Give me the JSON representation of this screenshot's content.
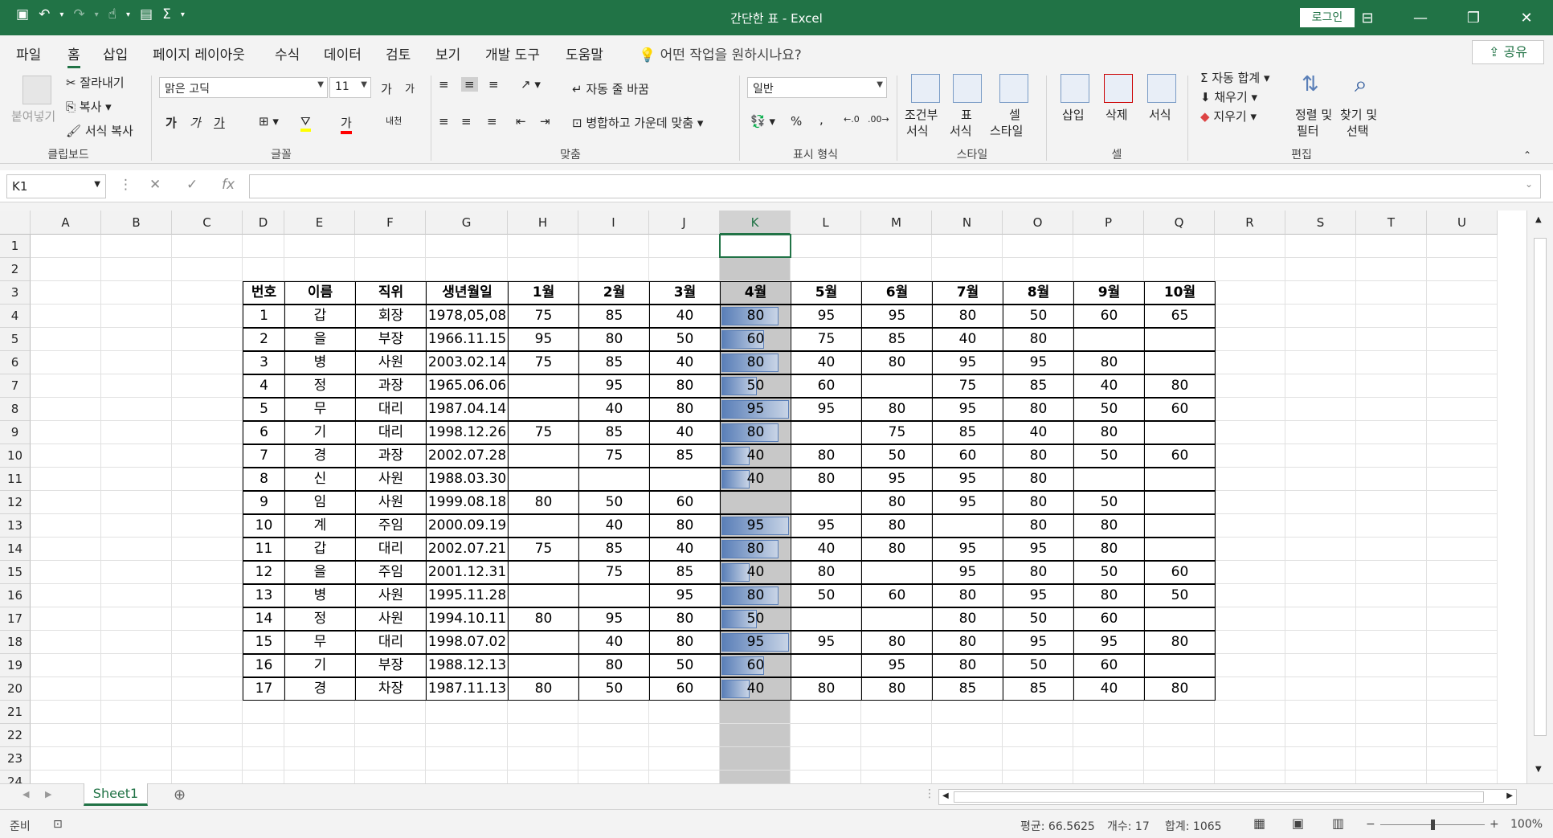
{
  "window": {
    "title": "간단한 표  -  Excel",
    "login_label": "로그인"
  },
  "menu": {
    "tabs": [
      "파일",
      "홈",
      "삽입",
      "페이지 레이아웃",
      "수식",
      "데이터",
      "검토",
      "보기",
      "개발 도구",
      "도움말"
    ],
    "tell_me": "어떤 작업을 원하시나요?",
    "share_label": "공유"
  },
  "ribbon": {
    "clipboard": {
      "paste": "붙여넣기",
      "cut": "잘라내기",
      "copy": "복사",
      "format_painter": "서식 복사",
      "group": "클립보드"
    },
    "font": {
      "name": "맑은 고딕",
      "size": "11",
      "group": "글꼴",
      "bold": "가",
      "italic": "가",
      "underline": "가",
      "grow": "가",
      "shrink": "가",
      "color": "가",
      "phonetic": "내천"
    },
    "alignment": {
      "wrap": "자동 줄 바꿈",
      "merge": "병합하고 가운데 맞춤",
      "group": "맞춤"
    },
    "number": {
      "format": "일반",
      "percent": "%",
      "comma": ",",
      "group": "표시 형식"
    },
    "styles": {
      "conditional_1": "조건부",
      "conditional_2": "서식",
      "table_1": "표",
      "table_2": "서식",
      "cell_1": "셀",
      "cell_2": "스타일",
      "group": "스타일"
    },
    "cells": {
      "insert": "삽입",
      "delete": "삭제",
      "format": "서식",
      "group": "셀"
    },
    "editing": {
      "autosum": "자동 합계",
      "fill": "채우기",
      "clear": "지우기",
      "sort_1": "정렬 및",
      "sort_2": "필터",
      "find_1": "찾기 및",
      "find_2": "선택",
      "group": "편집"
    }
  },
  "formula_bar": {
    "name_box": "K1",
    "cancel": "✕",
    "enter": "✓",
    "fx": "fx",
    "formula": ""
  },
  "sheet": {
    "columns": [
      "A",
      "B",
      "C",
      "D",
      "E",
      "F",
      "G",
      "H",
      "I",
      "J",
      "K",
      "L",
      "M",
      "N",
      "O",
      "P",
      "Q",
      "R",
      "S",
      "T",
      "U"
    ],
    "selected_column": "K",
    "rows": [
      "1",
      "2",
      "3",
      "4",
      "5",
      "6",
      "7",
      "8",
      "9",
      "10",
      "11",
      "12",
      "13",
      "14",
      "15",
      "16",
      "17",
      "18",
      "19",
      "20",
      "21",
      "22",
      "23",
      "24"
    ],
    "table_headers": [
      "번호",
      "이름",
      "직위",
      "생년월일",
      "1월",
      "2월",
      "3월",
      "4월",
      "5월",
      "6월",
      "7월",
      "8월",
      "9월",
      "10월"
    ],
    "table_rows": [
      [
        "1",
        "갑",
        "회장",
        "1978,05,08",
        "75",
        "85",
        "40",
        "80",
        "95",
        "95",
        "80",
        "50",
        "60",
        "65"
      ],
      [
        "2",
        "을",
        "부장",
        "1966.11.15",
        "95",
        "80",
        "50",
        "60",
        "75",
        "85",
        "40",
        "80",
        "",
        ""
      ],
      [
        "3",
        "병",
        "사원",
        "2003.02.14",
        "75",
        "85",
        "40",
        "80",
        "40",
        "80",
        "95",
        "95",
        "80",
        ""
      ],
      [
        "4",
        "정",
        "과장",
        "1965.06.06",
        "",
        "95",
        "80",
        "50",
        "60",
        "",
        "75",
        "85",
        "40",
        "80"
      ],
      [
        "5",
        "무",
        "대리",
        "1987.04.14",
        "",
        "40",
        "80",
        "95",
        "95",
        "80",
        "95",
        "80",
        "50",
        "60"
      ],
      [
        "6",
        "기",
        "대리",
        "1998.12.26",
        "75",
        "85",
        "40",
        "80",
        "",
        "75",
        "85",
        "40",
        "80",
        ""
      ],
      [
        "7",
        "경",
        "과장",
        "2002.07.28",
        "",
        "75",
        "85",
        "40",
        "80",
        "50",
        "60",
        "80",
        "50",
        "60"
      ],
      [
        "8",
        "신",
        "사원",
        "1988.03.30",
        "",
        "",
        "",
        "40",
        "80",
        "95",
        "95",
        "80",
        "",
        ""
      ],
      [
        "9",
        "임",
        "사원",
        "1999.08.18",
        "80",
        "50",
        "60",
        "",
        "",
        "80",
        "95",
        "80",
        "50",
        ""
      ],
      [
        "10",
        "계",
        "주임",
        "2000.09.19",
        "",
        "40",
        "80",
        "95",
        "95",
        "80",
        "",
        "80",
        "80",
        ""
      ],
      [
        "11",
        "갑",
        "대리",
        "2002.07.21",
        "75",
        "85",
        "40",
        "80",
        "40",
        "80",
        "95",
        "95",
        "80",
        ""
      ],
      [
        "12",
        "을",
        "주임",
        "2001.12.31",
        "",
        "75",
        "85",
        "40",
        "80",
        "",
        "95",
        "80",
        "50",
        "60"
      ],
      [
        "13",
        "병",
        "사원",
        "1995.11.28",
        "",
        "",
        "95",
        "80",
        "50",
        "60",
        "80",
        "95",
        "80",
        "50"
      ],
      [
        "14",
        "정",
        "사원",
        "1994.10.11",
        "80",
        "95",
        "80",
        "50",
        "",
        "",
        "80",
        "50",
        "60",
        ""
      ],
      [
        "15",
        "무",
        "대리",
        "1998.07.02",
        "",
        "40",
        "80",
        "95",
        "95",
        "80",
        "80",
        "95",
        "95",
        "80"
      ],
      [
        "16",
        "기",
        "부장",
        "1988.12.13",
        "",
        "80",
        "50",
        "60",
        "",
        "95",
        "80",
        "50",
        "60",
        ""
      ],
      [
        "17",
        "경",
        "차장",
        "1987.11.13",
        "80",
        "50",
        "60",
        "40",
        "80",
        "80",
        "85",
        "85",
        "40",
        "80"
      ]
    ],
    "tab_name": "Sheet1"
  },
  "status": {
    "ready": "준비",
    "average": "평균: 66.5625",
    "count": "개수: 17",
    "sum": "합계: 1065",
    "zoom": "100%",
    "zoom_fraction": 0.5
  },
  "colors": {
    "excel_green": "#217346",
    "databar": "#5a7fb8",
    "selected_col": "#c8c8c8"
  }
}
